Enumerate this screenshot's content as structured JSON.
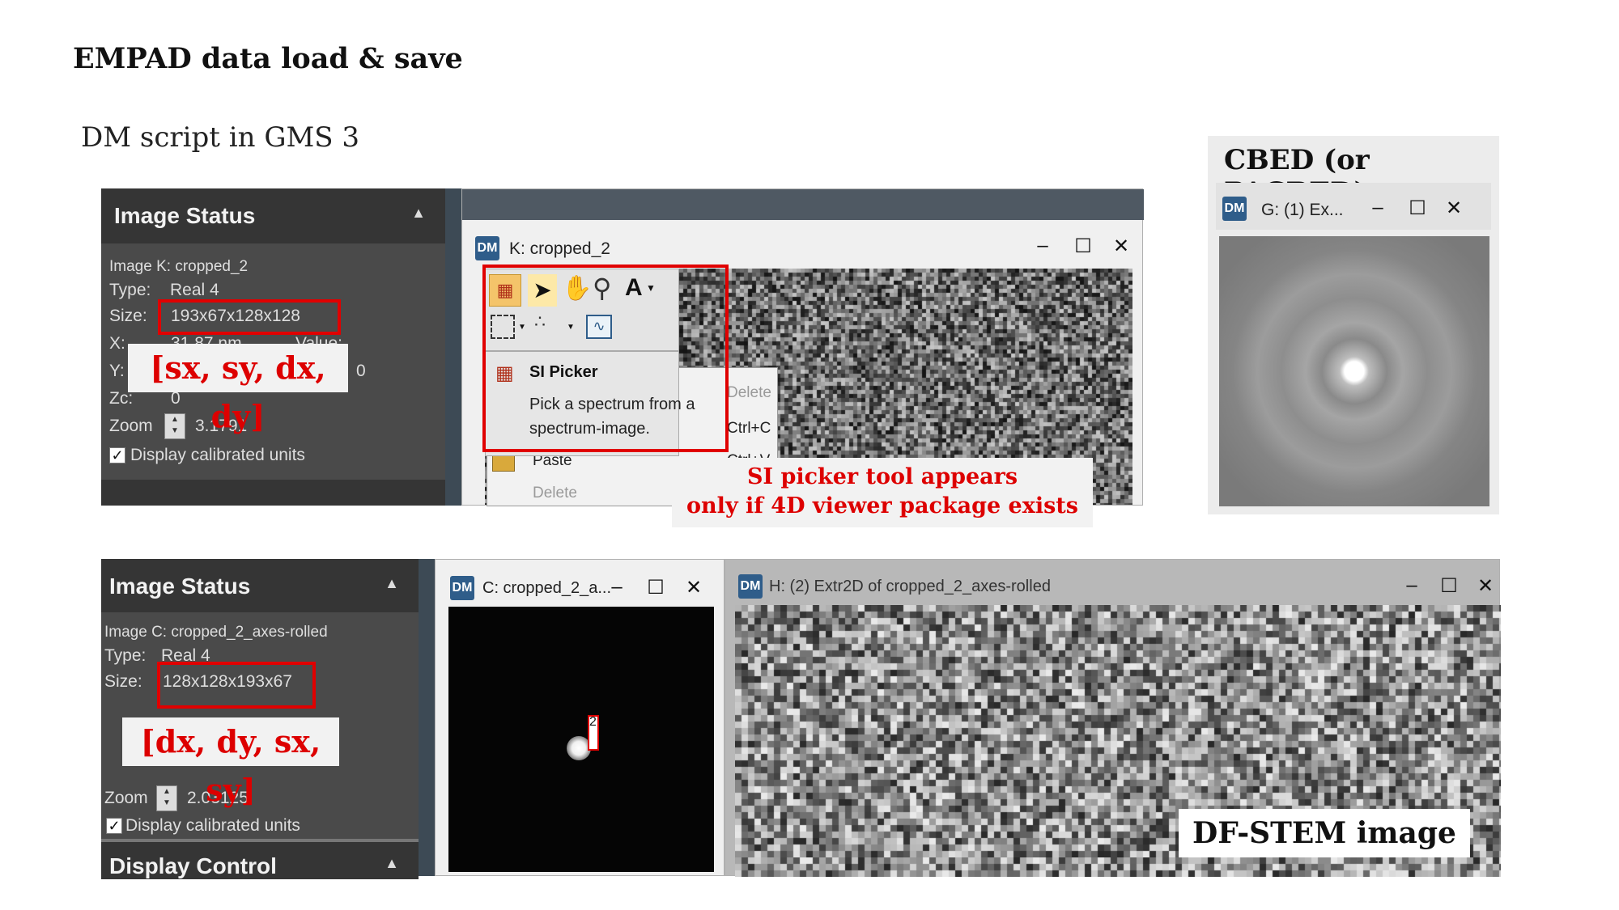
{
  "title": "EMPAD data load & save",
  "subtitle": "DM script in GMS 3",
  "top_panel": {
    "header": "Image Status",
    "image_line": "Image K: cropped_2",
    "type_label": "Type:",
    "type_value": "Real 4",
    "size_label": "Size:",
    "size_value": "193x67x128x128",
    "x_label": "X:",
    "x_value": "31.87 nm",
    "value_label": "Value:",
    "y_label": "Y:",
    "y_tail": "0",
    "zc_label": "Zc:",
    "zc_value": "0",
    "zoom_label": "Zoom",
    "zoom_value": "3.1791",
    "display_calibrated": "Display calibrated units",
    "annotation": "[sx, sy, dx, dy]"
  },
  "window_k": {
    "title": "K: cropped_2",
    "min": "–",
    "max": "☐",
    "close": "✕"
  },
  "tooltip": {
    "title": "SI Picker",
    "body_line1": "Pick a spectrum from a",
    "body_line2": "spectrum-image."
  },
  "context_menu": {
    "delete_top": "Delete",
    "copy_shortcut": "Ctrl+C",
    "paste": "Paste",
    "paste_shortcut": "Ctrl+V",
    "delete_bottom": "Delete"
  },
  "si_note": {
    "line1": "SI picker tool appears",
    "line2": "only if 4D viewer package exists"
  },
  "cbed": {
    "label": "CBED (or PACBED)",
    "window_title": "G: (1) Ex...",
    "min": "–",
    "max": "☐",
    "close": "✕"
  },
  "bottom_panel": {
    "header": "Image Status",
    "image_line": "Image C: cropped_2_axes-rolled",
    "type_label": "Type:",
    "type_value": "Real 4",
    "size_label": "Size:",
    "size_value": "128x128x193x67",
    "zoom_label": "Zoom",
    "zoom_value": "2.03125",
    "display_calibrated": "Display calibrated units",
    "annotation": "[dx, dy, sx, sy]",
    "display_control": "Display Control"
  },
  "window_c": {
    "title": "C: cropped_2_a...",
    "marker": "2",
    "min": "–",
    "max": "☐",
    "close": "✕"
  },
  "window_h": {
    "title": "H: (2) Extr2D of cropped_2_axes-rolled",
    "min": "–",
    "max": "☐",
    "close": "✕"
  },
  "df_stem_label": "DF-STEM image",
  "colors": {
    "annotation_red": "#dd0000",
    "panel_bg": "#4a4a4a",
    "panel_header": "#353535"
  }
}
